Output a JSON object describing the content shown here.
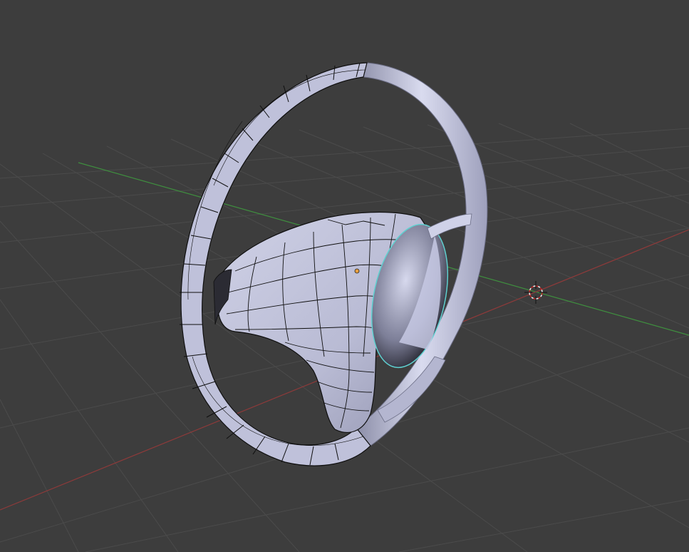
{
  "viewport": {
    "mode": "edit-mode-3d-viewport",
    "background_color": "#3d3d3d",
    "grid_color": "#4a4a4a",
    "x_axis_color": "#8f3a3a",
    "y_axis_color": "#3f8f3f",
    "mesh_color": "#c8cae6",
    "wire_color": "#111111",
    "selected_edge_color": "#5fd0d0",
    "origin_color": "#e8a040",
    "cursor_color": "#cc2222"
  },
  "icons": {
    "cursor": "3d-cursor-icon",
    "origin": "object-origin-icon"
  }
}
